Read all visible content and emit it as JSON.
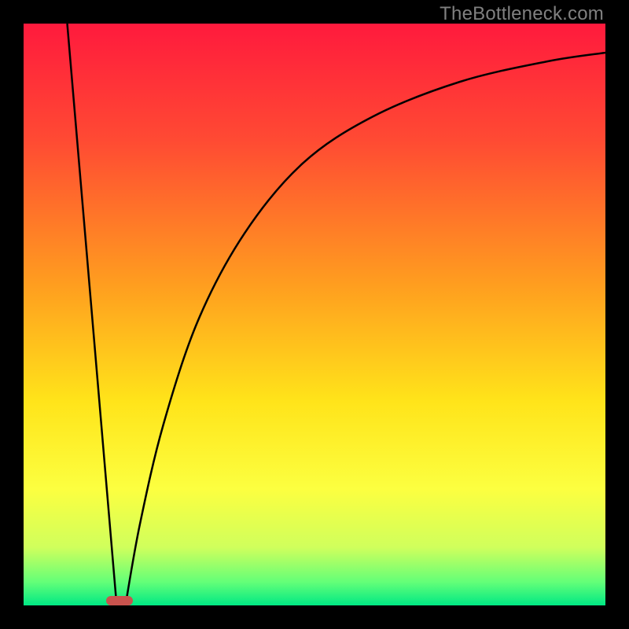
{
  "watermark": "TheBottleneck.com",
  "chart_data": {
    "type": "line",
    "title": "",
    "xlabel": "",
    "ylabel": "",
    "xlim": [
      0,
      100
    ],
    "ylim": [
      0,
      100
    ],
    "grid": false,
    "legend": false,
    "annotations": [],
    "gradient_stops": [
      {
        "offset": 0,
        "color": "#ff1a3d"
      },
      {
        "offset": 20,
        "color": "#ff4a33"
      },
      {
        "offset": 45,
        "color": "#ff9e1f"
      },
      {
        "offset": 65,
        "color": "#ffe41a"
      },
      {
        "offset": 80,
        "color": "#fcff40"
      },
      {
        "offset": 90,
        "color": "#d0ff5c"
      },
      {
        "offset": 96,
        "color": "#63ff78"
      },
      {
        "offset": 100,
        "color": "#00e884"
      }
    ],
    "series": [
      {
        "name": "left-line",
        "x": [
          7.5,
          16.0
        ],
        "y": [
          100,
          0
        ]
      },
      {
        "name": "right-curve",
        "x": [
          17.5,
          20,
          24,
          30,
          38,
          48,
          60,
          75,
          90,
          100
        ],
        "y": [
          0,
          14,
          31,
          49,
          64,
          76,
          84,
          90,
          93.5,
          95
        ]
      }
    ],
    "marker": {
      "name": "bottleneck-marker",
      "x_center": 16.5,
      "width_pct": 4.5,
      "height_pct": 1.6,
      "color": "#c9534e"
    }
  }
}
